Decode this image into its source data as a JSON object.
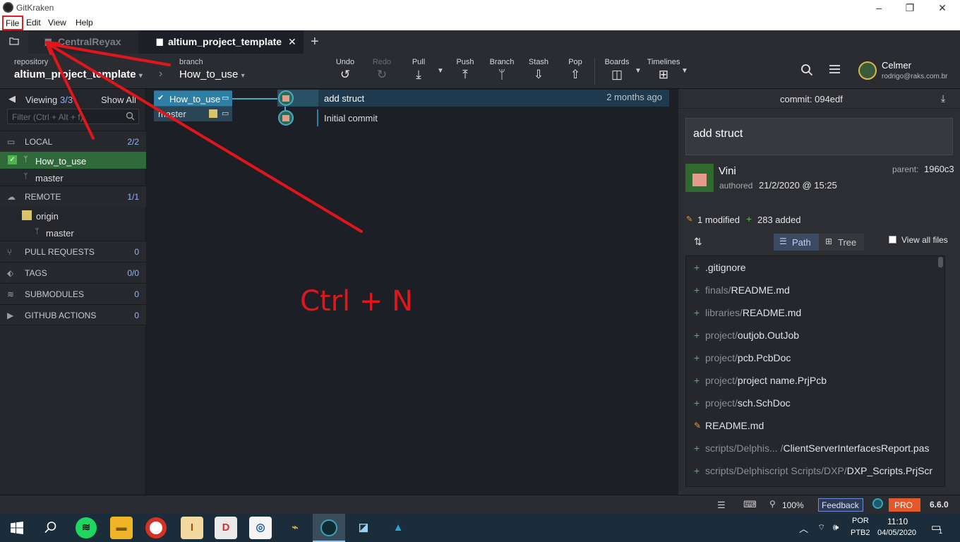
{
  "app": {
    "window_title": "GitKraken"
  },
  "menu": [
    "File",
    "Edit",
    "View",
    "Help"
  ],
  "tabs": [
    {
      "label": "CentralReyax",
      "active": false
    },
    {
      "label": "altium_project_template",
      "active": true
    }
  ],
  "toolbar": {
    "repository_label": "repository",
    "repository_name": "altium_project_template",
    "branch_label": "branch",
    "branch_name": "How_to_use",
    "buttons": [
      {
        "label": "Undo",
        "icon": "undo-icon",
        "glyph": "↺",
        "enabled": true
      },
      {
        "label": "Redo",
        "icon": "redo-icon",
        "glyph": "↻",
        "enabled": false
      },
      {
        "label": "Pull",
        "icon": "pull-icon",
        "glyph": "⤓",
        "enabled": true
      },
      {
        "label": "Push",
        "icon": "push-icon",
        "glyph": "⤒",
        "enabled": true
      },
      {
        "label": "Branch",
        "icon": "branch-icon",
        "glyph": "ᛘ",
        "enabled": true
      },
      {
        "label": "Stash",
        "icon": "stash-icon",
        "glyph": "⇩",
        "enabled": true
      },
      {
        "label": "Pop",
        "icon": "pop-icon",
        "glyph": "⇧",
        "enabled": true
      }
    ],
    "boards_label": "Boards",
    "timelines_label": "Timelines",
    "user_name": "Celmer",
    "user_email": "rodrigo@raks.com.br"
  },
  "sidebar": {
    "viewing_label": "Viewing",
    "viewing_count": "3/3",
    "show_all": "Show All",
    "filter_placeholder": "Filter (Ctrl + Alt + f)",
    "local": {
      "label": "LOCAL",
      "count": "2/2",
      "branches": [
        "How_to_use",
        "master"
      ]
    },
    "remote": {
      "label": "REMOTE",
      "count": "1/1",
      "origin": "origin",
      "branches": [
        "master"
      ]
    },
    "pull_requests": {
      "label": "PULL REQUESTS",
      "count": "0"
    },
    "tags": {
      "label": "TAGS",
      "count": "0/0"
    },
    "submodules": {
      "label": "SUBMODULES",
      "count": "0"
    },
    "github_actions": {
      "label": "GITHUB ACTIONS",
      "count": "0"
    }
  },
  "graph": {
    "refs": [
      "How_to_use",
      "master"
    ],
    "commits": [
      {
        "message": "add struct",
        "time": "2 months ago"
      },
      {
        "message": "Initial commit",
        "time": ""
      }
    ]
  },
  "annotation": {
    "text": "Ctrl + N",
    "color": "#e0161b"
  },
  "commit_detail": {
    "header": "commit: 094edf",
    "summary": "add struct",
    "author": "Vini",
    "authored_label": "authored",
    "date": "21/2/2020 @ 15:25",
    "parent_label": "parent:",
    "parent": "1960c3",
    "modified": "1 modified",
    "added": "283 added",
    "path_label": "Path",
    "tree_label": "Tree",
    "view_all": "View all files",
    "files": [
      {
        "status": "added",
        "dir": "",
        "name": ".gitignore"
      },
      {
        "status": "added",
        "dir": "finals/",
        "name": "README.md"
      },
      {
        "status": "added",
        "dir": "libraries/",
        "name": "README.md"
      },
      {
        "status": "added",
        "dir": "project/",
        "name": "outjob.OutJob"
      },
      {
        "status": "added",
        "dir": "project/",
        "name": "pcb.PcbDoc"
      },
      {
        "status": "added",
        "dir": "project/",
        "name": "project name.PrjPcb"
      },
      {
        "status": "added",
        "dir": "project/",
        "name": "sch.SchDoc"
      },
      {
        "status": "modified",
        "dir": "",
        "name": "README.md"
      },
      {
        "status": "added",
        "dir": "scripts/Delphis... /",
        "name": "ClientServerInterfacesReport.pas"
      },
      {
        "status": "added",
        "dir": "scripts/Delphiscript Scripts/DXP/",
        "name": "DXP_Scripts.PrjScr"
      }
    ]
  },
  "statusbar": {
    "zoom": "100%",
    "feedback": "Feedback",
    "pro": "PRO",
    "version": "6.6.0"
  },
  "taskbar": {
    "lang1": "POR",
    "lang2": "PTB2",
    "time": "11:10",
    "date": "04/05/2020",
    "notif_count": "1"
  },
  "colors": {
    "accent": "#4aa9c9",
    "selected_branch": "#2f6b3a",
    "annotation": "#e0161b",
    "pro": "#e6582a"
  }
}
